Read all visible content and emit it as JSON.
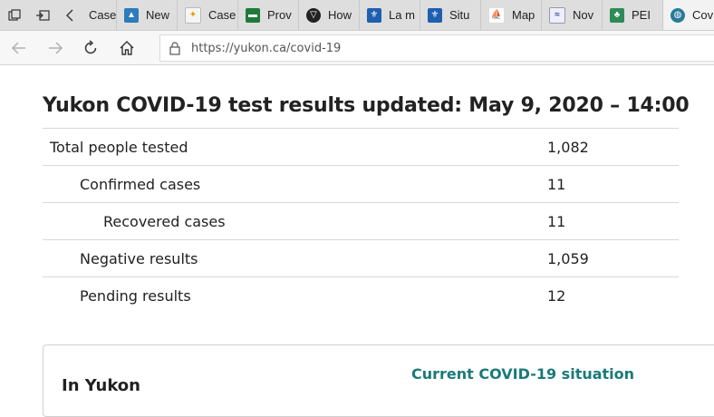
{
  "browser": {
    "tabs": [
      {
        "label": "Case",
        "icon": "page-icon",
        "color": "#3a6ea5"
      },
      {
        "label": "New",
        "icon": "stats-icon",
        "color": "#2b7bbd"
      },
      {
        "label": "Case",
        "icon": "alberta-icon",
        "color": "#e0a000"
      },
      {
        "label": "Prov",
        "icon": "province-icon",
        "color": "#1f7a3a"
      },
      {
        "label": "How",
        "icon": "ontario-icon",
        "color": "#222222"
      },
      {
        "label": "La m",
        "icon": "quebec-icon",
        "color": "#1f5fb0"
      },
      {
        "label": "Situ",
        "icon": "quebec-icon",
        "color": "#1f5fb0"
      },
      {
        "label": "Map",
        "icon": "nb-icon",
        "color": "#c0392b"
      },
      {
        "label": "Nov",
        "icon": "ns-icon",
        "color": "#3b4f8a"
      },
      {
        "label": "PEI",
        "icon": "pei-icon",
        "color": "#2e8b57"
      },
      {
        "label": "Covi",
        "icon": "globe-icon",
        "color": "#2a7a9a"
      }
    ],
    "url": "https://yukon.ca/covid-19"
  },
  "page": {
    "title": "Yukon COVID-19 test results updated: May 9, 2020 – 14:00",
    "results": [
      {
        "label": "Total people tested",
        "value": "1,082",
        "level": 0
      },
      {
        "label": "Confirmed cases",
        "value": "11",
        "level": 1
      },
      {
        "label": "Recovered cases",
        "value": "11",
        "level": 2
      },
      {
        "label": "Negative results",
        "value": "1,059",
        "level": 1
      },
      {
        "label": "Pending results",
        "value": "12",
        "level": 1
      }
    ],
    "card": {
      "heading": "In Yukon",
      "link": "Current COVID-19 situation"
    }
  },
  "colors": {
    "link": "#1b7a7a"
  }
}
